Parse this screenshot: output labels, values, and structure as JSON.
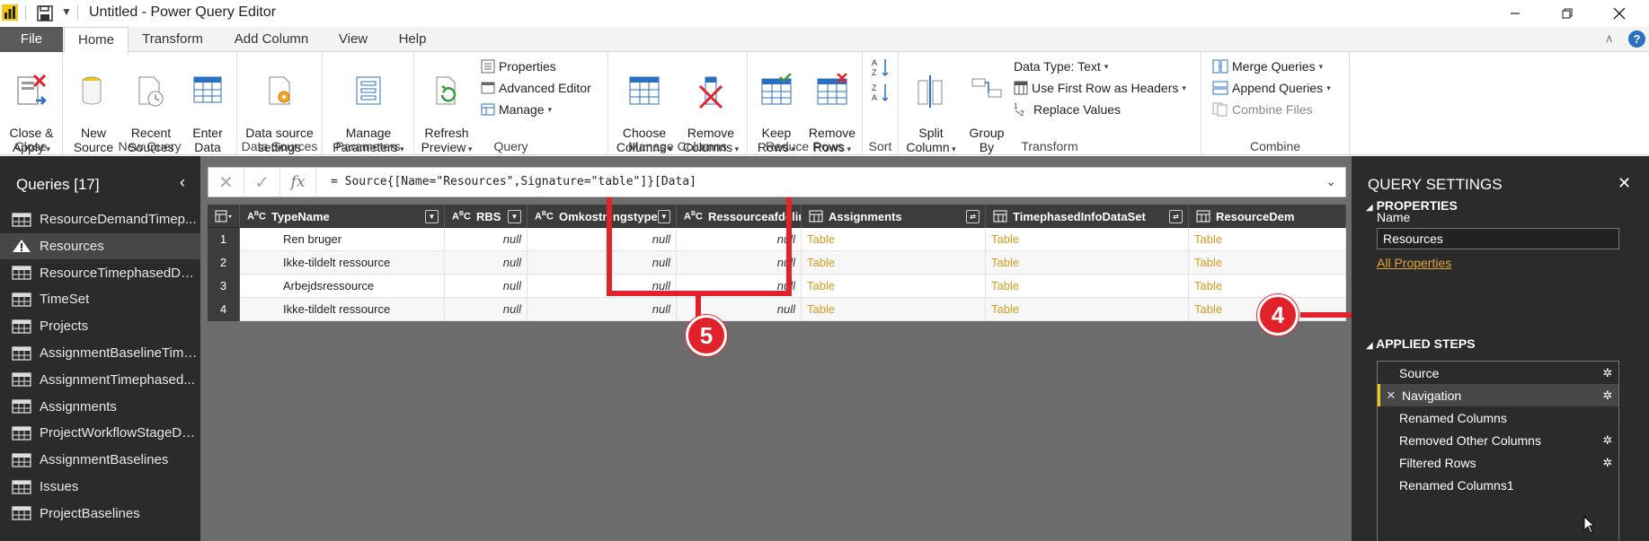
{
  "window": {
    "title": "Untitled - Power Query Editor"
  },
  "tabs": [
    "File",
    "Home",
    "Transform",
    "Add Column",
    "View",
    "Help"
  ],
  "ribbon": {
    "close": {
      "btn": "Close &\nApply",
      "label": "Close"
    },
    "new_query": {
      "new_source": "New\nSource",
      "recent_sources": "Recent\nSources",
      "enter_data": "Enter\nData",
      "label": "New Query"
    },
    "data_sources": {
      "btn": "Data source\nsettings",
      "label": "Data Sources"
    },
    "parameters": {
      "btn": "Manage\nParameters",
      "label": "Parameters"
    },
    "query": {
      "refresh": "Refresh\nPreview",
      "properties": "Properties",
      "advanced_editor": "Advanced Editor",
      "manage": "Manage",
      "label": "Query"
    },
    "manage_columns": {
      "choose": "Choose\nColumns",
      "remove": "Remove\nColumns",
      "label": "Manage Columns"
    },
    "reduce_rows": {
      "keep": "Keep\nRows",
      "remove": "Remove\nRows",
      "label": "Reduce Rows"
    },
    "sort": {
      "label": "Sort"
    },
    "transform": {
      "split": "Split\nColumn",
      "group": "Group\nBy",
      "data_type": "Data Type: Text",
      "first_row": "Use First Row as Headers",
      "replace": "Replace Values",
      "label": "Transform"
    },
    "combine": {
      "merge": "Merge Queries",
      "append": "Append Queries",
      "combine_files": "Combine Files",
      "label": "Combine"
    }
  },
  "queries": {
    "header": "Queries [17]",
    "items": [
      {
        "name": "ResourceDemandTimep...",
        "icon": "table-icon"
      },
      {
        "name": "Resources",
        "icon": "warning-icon",
        "selected": true
      },
      {
        "name": "ResourceTimephasedDat...",
        "icon": "table-icon"
      },
      {
        "name": "TimeSet",
        "icon": "table-icon"
      },
      {
        "name": "Projects",
        "icon": "table-icon"
      },
      {
        "name": "AssignmentBaselineTime...",
        "icon": "table-icon"
      },
      {
        "name": "AssignmentTimephased...",
        "icon": "table-icon"
      },
      {
        "name": "Assignments",
        "icon": "table-icon"
      },
      {
        "name": "ProjectWorkflowStageDa...",
        "icon": "table-icon"
      },
      {
        "name": "AssignmentBaselines",
        "icon": "table-icon"
      },
      {
        "name": "Issues",
        "icon": "table-icon"
      },
      {
        "name": "ProjectBaselines",
        "icon": "table-icon"
      }
    ]
  },
  "formula": "= Source{[Name=\"Resources\",Signature=\"table\"]}[Data]",
  "grid": {
    "columns": [
      "TypeName",
      "RBS",
      "Omkostningstype",
      "Ressourceafdelinger",
      "Assignments",
      "TimephasedInfoDataSet",
      "ResourceDem"
    ],
    "rows": [
      {
        "n": "1",
        "cells": [
          "Ren bruger",
          "null",
          "null",
          "null",
          "Table",
          "Table",
          "Table"
        ]
      },
      {
        "n": "2",
        "cells": [
          "Ikke-tildelt ressource",
          "null",
          "null",
          "null",
          "Table",
          "Table",
          "Table"
        ]
      },
      {
        "n": "3",
        "cells": [
          "Arbejdsressource",
          "null",
          "null",
          "null",
          "Table",
          "Table",
          "Table"
        ]
      },
      {
        "n": "4",
        "cells": [
          "Ikke-tildelt ressource",
          "null",
          "null",
          "null",
          "Table",
          "Table",
          "Table"
        ]
      }
    ]
  },
  "callouts": {
    "five": "5",
    "four": "4"
  },
  "settings": {
    "header": "QUERY SETTINGS",
    "properties": "PROPERTIES",
    "name_label": "Name",
    "name_value": "Resources",
    "all_properties": "All Properties",
    "applied_steps": "APPLIED STEPS",
    "steps": [
      {
        "name": "Source",
        "gear": true
      },
      {
        "name": "Navigation",
        "gear": true,
        "selected": true
      },
      {
        "name": "Renamed Columns",
        "gear": false
      },
      {
        "name": "Removed Other Columns",
        "gear": true
      },
      {
        "name": "Filtered Rows",
        "gear": true
      },
      {
        "name": "Renamed Columns1",
        "gear": false
      }
    ]
  },
  "colors": {
    "accent": "#f2c811",
    "callout": "#e2222a",
    "table_link": "#d39b1e",
    "panel": "#2b2b2b"
  }
}
